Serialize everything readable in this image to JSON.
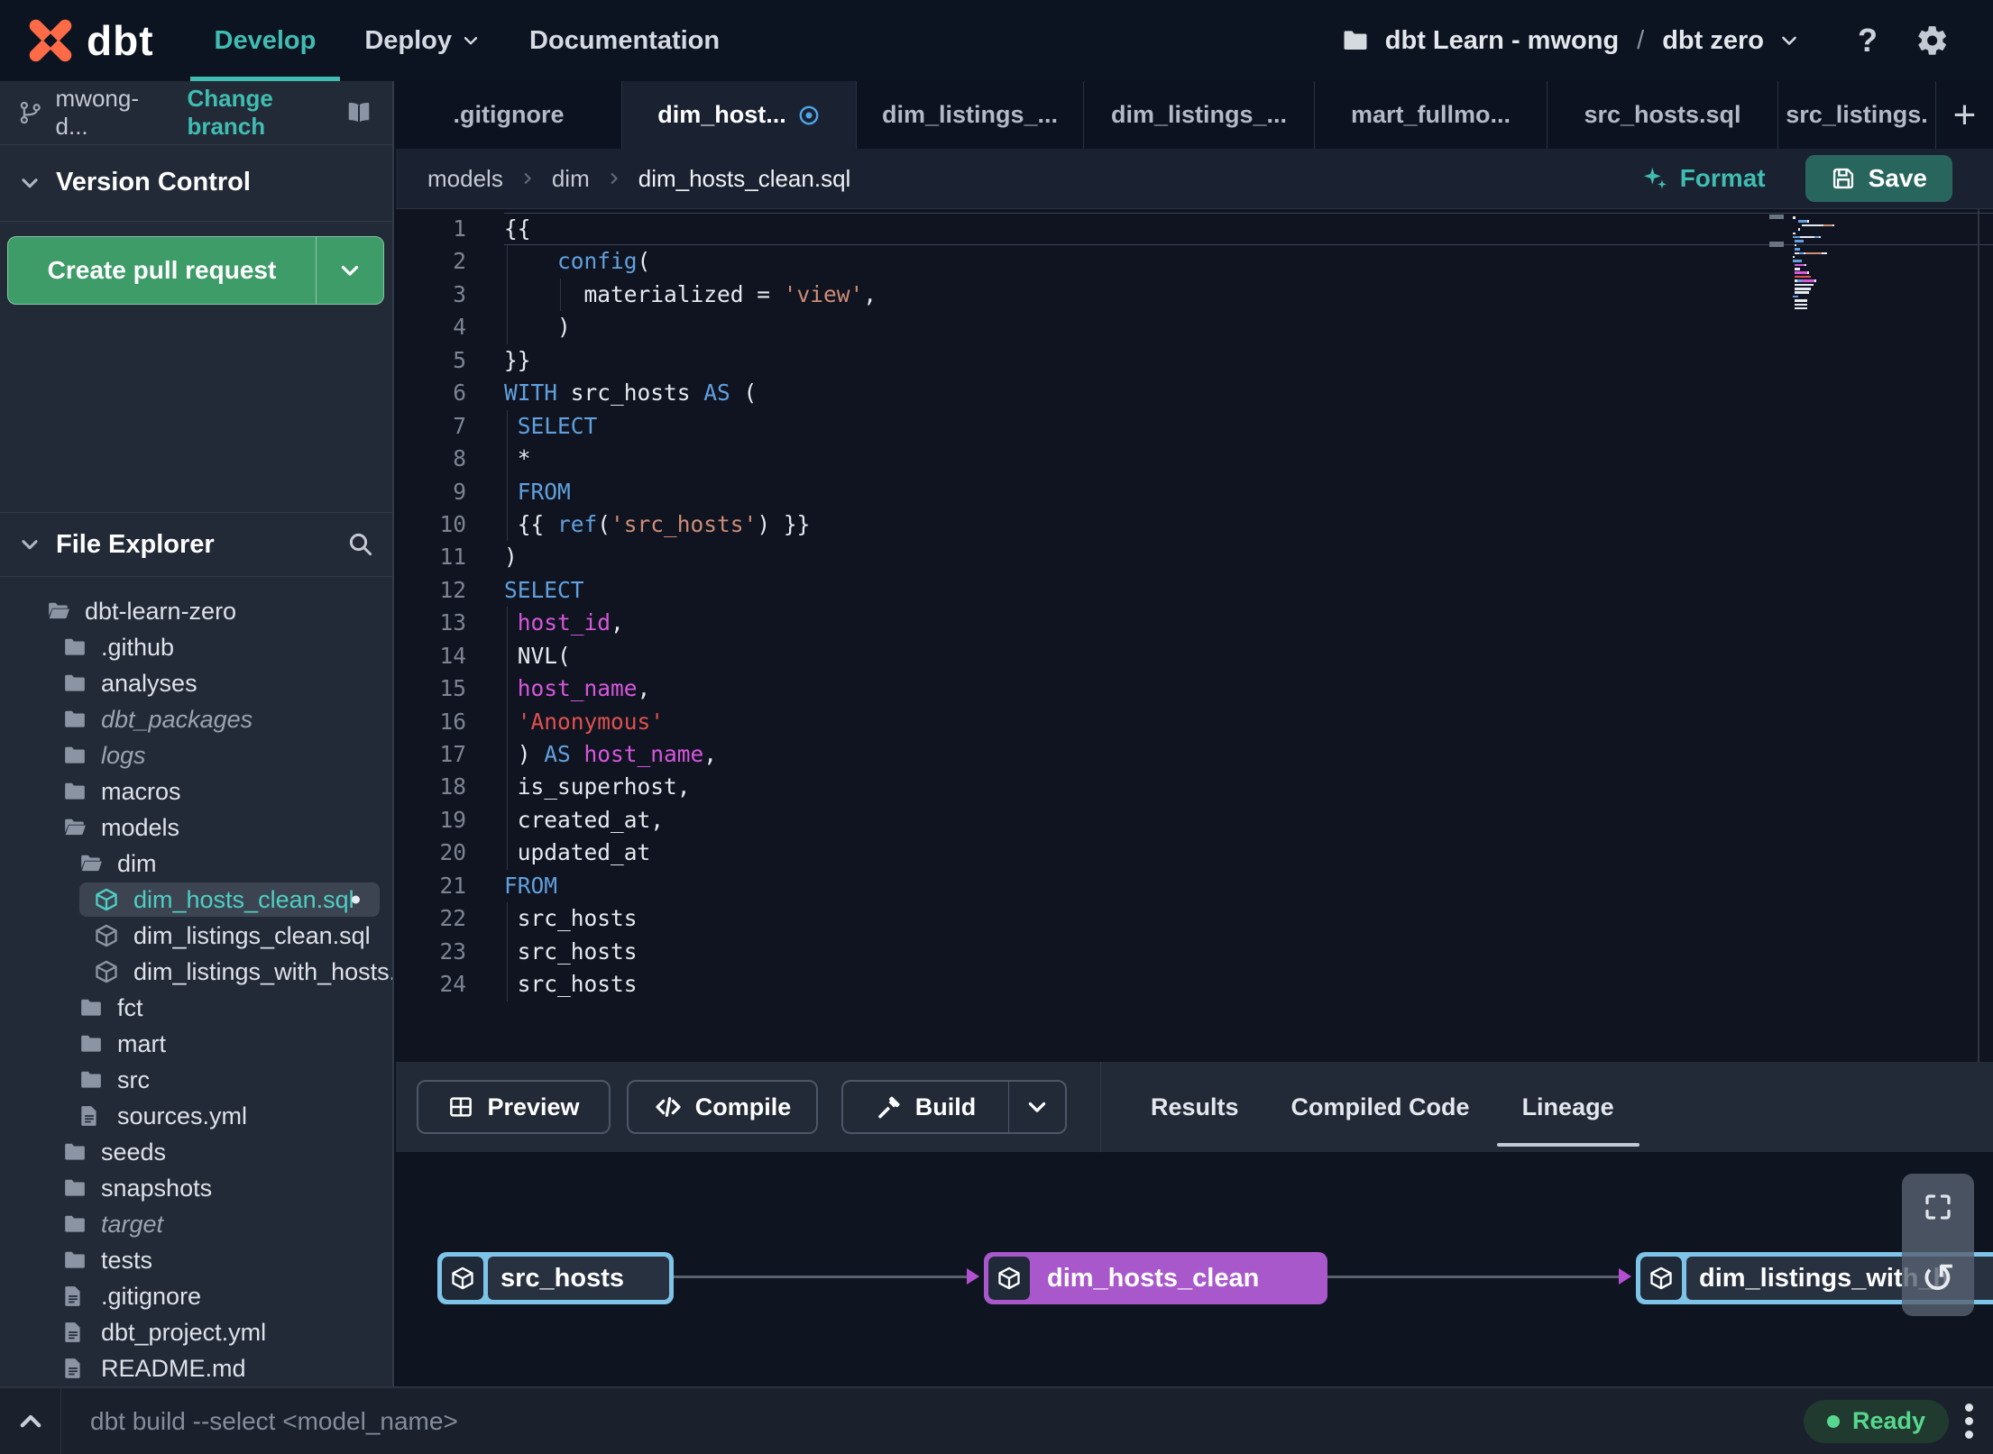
{
  "colors": {
    "accent_teal": "#40bdb2",
    "logo_orange": "#ff6a47",
    "pr_button_green": "#3d9c68",
    "save_button_teal": "#27655d",
    "modified_blue": "#4da6e8",
    "ready_green": "#57d78e",
    "node_source_blue": "#7ec3e8",
    "node_model_purple": "#a958cc",
    "arrow_purple": "#b44fd1",
    "code": {
      "default": "#e7eaf0",
      "keyword": "#61a0dd",
      "column": "#d757dd",
      "string_red": "#e0514f",
      "string_orange": "#cf8d77",
      "line_number": "#7d8593"
    }
  },
  "topnav": {
    "logo_text": "dbt",
    "develop": "Develop",
    "deploy": "Deploy",
    "documentation": "Documentation",
    "account": "dbt Learn - mwong",
    "separator": "/",
    "project": "dbt zero",
    "help": "?"
  },
  "sidebar": {
    "branch_name": "mwong-d...",
    "change_branch": "Change branch",
    "version_control": "Version Control",
    "create_pr": "Create pull request",
    "file_explorer": "File Explorer",
    "tree": [
      {
        "label": "dbt-learn-zero",
        "icon": "folder-open",
        "level": 0
      },
      {
        "label": ".github",
        "icon": "folder",
        "level": 1
      },
      {
        "label": "analyses",
        "icon": "folder",
        "level": 1
      },
      {
        "label": "dbt_packages",
        "icon": "folder",
        "level": 1,
        "italic": true
      },
      {
        "label": "logs",
        "icon": "folder",
        "level": 1,
        "italic": true
      },
      {
        "label": "macros",
        "icon": "folder",
        "level": 1
      },
      {
        "label": "models",
        "icon": "folder-open",
        "level": 1
      },
      {
        "label": "dim",
        "icon": "folder-open",
        "level": 2
      },
      {
        "label": "dim_hosts_clean.sql",
        "icon": "model",
        "level": 3,
        "selected": true,
        "modified": true
      },
      {
        "label": "dim_listings_clean.sql",
        "icon": "model",
        "level": 3
      },
      {
        "label": "dim_listings_with_hosts...",
        "icon": "model",
        "level": 3
      },
      {
        "label": "fct",
        "icon": "folder",
        "level": 2
      },
      {
        "label": "mart",
        "icon": "folder",
        "level": 2
      },
      {
        "label": "src",
        "icon": "folder",
        "level": 2
      },
      {
        "label": "sources.yml",
        "icon": "file",
        "level": 2
      },
      {
        "label": "seeds",
        "icon": "folder",
        "level": 1
      },
      {
        "label": "snapshots",
        "icon": "folder",
        "level": 1
      },
      {
        "label": "target",
        "icon": "folder",
        "level": 1,
        "italic": true
      },
      {
        "label": "tests",
        "icon": "folder",
        "level": 1
      },
      {
        "label": ".gitignore",
        "icon": "file",
        "level": 1
      },
      {
        "label": "dbt_project.yml",
        "icon": "file",
        "level": 1
      },
      {
        "label": "README.md",
        "icon": "file",
        "level": 1
      }
    ]
  },
  "editor": {
    "tabs": [
      {
        "label": ".gitignore"
      },
      {
        "label": "dim_host...",
        "active": true,
        "modified": true
      },
      {
        "label": "dim_listings_..."
      },
      {
        "label": "dim_listings_..."
      },
      {
        "label": "mart_fullmo..."
      },
      {
        "label": "src_hosts.sql"
      },
      {
        "label": "src_listings."
      }
    ],
    "new_tab": "+",
    "breadcrumb": [
      "models",
      "dim",
      "dim_hosts_clean.sql"
    ],
    "format": "Format",
    "save": "Save",
    "active_line": 1,
    "lines": [
      [
        [
          "{{",
          "d"
        ]
      ],
      [
        [
          "    ",
          "d"
        ],
        [
          "config",
          "k"
        ],
        [
          "(",
          "d"
        ]
      ],
      [
        [
          "      materialized = ",
          "d"
        ],
        [
          "'view'",
          "o"
        ],
        [
          ",",
          "d"
        ]
      ],
      [
        [
          "    )",
          "d"
        ]
      ],
      [
        [
          "}}",
          "d"
        ]
      ],
      [
        [
          "WITH ",
          "k"
        ],
        [
          "src_hosts ",
          "d"
        ],
        [
          "AS ",
          "k"
        ],
        [
          "(",
          "d"
        ]
      ],
      [
        [
          " ",
          "d"
        ],
        [
          "SELECT",
          "k"
        ]
      ],
      [
        [
          " *",
          "d"
        ]
      ],
      [
        [
          " ",
          "d"
        ],
        [
          "FROM",
          "k"
        ]
      ],
      [
        [
          " {{ ",
          "d"
        ],
        [
          "ref",
          "k"
        ],
        [
          "(",
          "d"
        ],
        [
          "'src_hosts'",
          "o"
        ],
        [
          ") }}",
          "d"
        ]
      ],
      [
        [
          ")",
          "d"
        ]
      ],
      [
        [
          "SELECT",
          "k"
        ]
      ],
      [
        [
          " ",
          "d"
        ],
        [
          "host_id",
          "c"
        ],
        [
          ",",
          "d"
        ]
      ],
      [
        [
          " NVL(",
          "d"
        ]
      ],
      [
        [
          " ",
          "d"
        ],
        [
          "host_name",
          "c"
        ],
        [
          ",",
          "d"
        ]
      ],
      [
        [
          " ",
          "d"
        ],
        [
          "'Anonymous'",
          "r"
        ]
      ],
      [
        [
          " ) ",
          "d"
        ],
        [
          "AS ",
          "k"
        ],
        [
          "host_name",
          "c"
        ],
        [
          ",",
          "d"
        ]
      ],
      [
        [
          " is_superhost,",
          "d"
        ]
      ],
      [
        [
          " created_at,",
          "d"
        ]
      ],
      [
        [
          " updated_at",
          "d"
        ]
      ],
      [
        [
          "FROM",
          "k"
        ]
      ],
      [
        [
          " src_hosts",
          "d"
        ]
      ],
      [
        [
          " src_hosts",
          "d"
        ]
      ],
      [
        [
          " src_hosts",
          "d"
        ]
      ]
    ]
  },
  "panel": {
    "preview": "Preview",
    "compile": "Compile",
    "build": "Build",
    "tabs": [
      {
        "label": "Results"
      },
      {
        "label": "Compiled Code"
      },
      {
        "label": "Lineage",
        "active": true
      }
    ]
  },
  "lineage": {
    "nodes": [
      {
        "label": "src_hosts",
        "type": "source"
      },
      {
        "label": "dim_hosts_clean",
        "type": "model"
      },
      {
        "label": "dim_listings_with_h",
        "type": "source"
      }
    ]
  },
  "statusbar": {
    "command": "dbt build --select <model_name>",
    "status": "Ready"
  }
}
